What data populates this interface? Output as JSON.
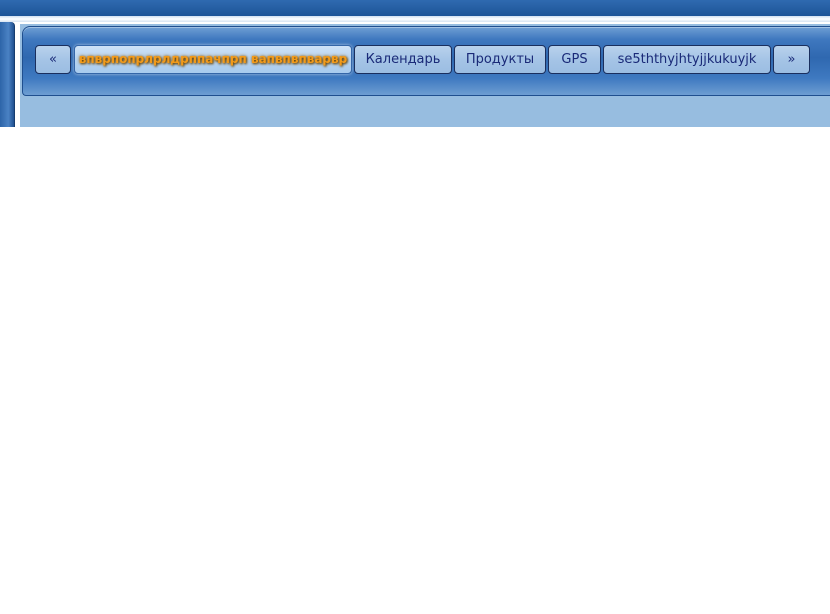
{
  "nav": {
    "prev_label": "«",
    "next_label": "»",
    "items": [
      {
        "label": "впврпопрлрлдрппачпрп вапвпвпварвр",
        "active": true
      },
      {
        "label": "Календарь",
        "active": false
      },
      {
        "label": "Продукты",
        "active": false
      },
      {
        "label": "GPS",
        "active": false
      },
      {
        "label": "se5ththyjhtyjjkukuyjk",
        "active": false
      }
    ]
  }
}
